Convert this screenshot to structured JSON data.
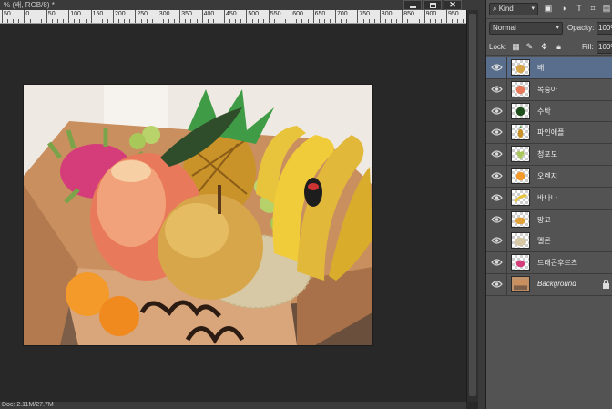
{
  "document": {
    "tab_title": "% (배, RGB/8) *"
  },
  "ruler": {
    "labels": [
      "50",
      "0",
      "50",
      "100",
      "150",
      "200",
      "250",
      "300",
      "350",
      "400",
      "450",
      "500",
      "550",
      "600",
      "650",
      "700",
      "750",
      "800",
      "850",
      "900",
      "950"
    ]
  },
  "status": {
    "text": "Doc: 2.11M/27.7M"
  },
  "layers_panel": {
    "filter_kind": "Kind",
    "blend_mode": "Normal",
    "opacity_label": "Opacity:",
    "opacity_value": "100%",
    "lock_label": "Lock:",
    "fill_label": "Fill:",
    "fill_value": "100%",
    "layers": [
      {
        "name": "배",
        "selected": true,
        "thumb": "pear"
      },
      {
        "name": "복숭아",
        "selected": false,
        "thumb": "peach"
      },
      {
        "name": "수박",
        "selected": false,
        "thumb": "watermelon"
      },
      {
        "name": "파인애플",
        "selected": false,
        "thumb": "pineapple"
      },
      {
        "name": "청포도",
        "selected": false,
        "thumb": "grape"
      },
      {
        "name": "오렌지",
        "selected": false,
        "thumb": "orange"
      },
      {
        "name": "바나나",
        "selected": false,
        "thumb": "banana"
      },
      {
        "name": "망고",
        "selected": false,
        "thumb": "mango"
      },
      {
        "name": "멜론",
        "selected": false,
        "thumb": "melon"
      },
      {
        "name": "드래곤후르츠",
        "selected": false,
        "thumb": "dragonfruit"
      },
      {
        "name": "Background",
        "selected": false,
        "thumb": "background",
        "locked": true
      }
    ]
  },
  "colors": {
    "selected_layer": "#596e8c",
    "panel_bg": "#535353",
    "canvas_bg": "#282828"
  }
}
